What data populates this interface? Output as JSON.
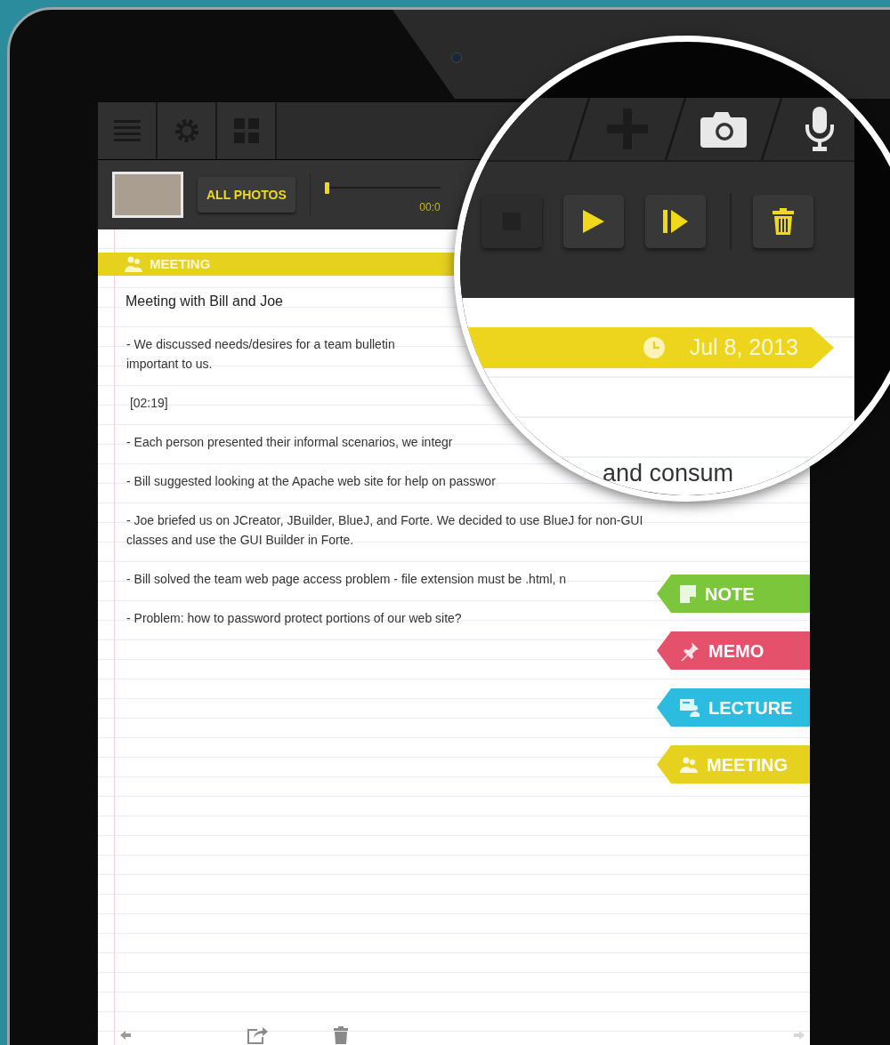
{
  "toolbar": {
    "buttons": [
      {
        "kind": "menu"
      },
      {
        "kind": "settings"
      },
      {
        "kind": "grid"
      }
    ]
  },
  "media_bar": {
    "photos_button": "ALL PHOTOS",
    "timeline": {
      "level": 0
    },
    "time": "00:0"
  },
  "category": {
    "kind": "meeting",
    "label": "MEETING"
  },
  "note": {
    "title": "Meeting with Bill and Joe",
    "paragraphs": [
      {
        "lines": [
          "- We discussed needs/desires for a team bulletin",
          "important to us."
        ]
      },
      {
        "lines": [
          " [02:19]"
        ]
      },
      {
        "lines": [
          "- Each person presented their informal scenarios, we integr"
        ]
      },
      {
        "lines": [
          "- Bill suggested looking at the Apache web site for help on passwor"
        ]
      },
      {
        "lines": [
          "- Joe briefed us on JCreator, JBuilder, BlueJ, and Forte. We decided to use BlueJ for non-GUI",
          "classes and use the GUI Builder in Forte."
        ]
      },
      {
        "lines": [
          "- Bill solved the team web page access problem - file extension must be .html, n"
        ]
      },
      {
        "lines": [
          "- Problem: how to password protect portions of our web site?"
        ]
      }
    ]
  },
  "tags": [
    {
      "kind": "note",
      "label": "NOTE",
      "color": "#7cc63c"
    },
    {
      "kind": "memo",
      "label": "MEMO",
      "color": "#e5506a"
    },
    {
      "kind": "lecture",
      "label": "LECTURE",
      "color": "#2bbcdf"
    },
    {
      "kind": "meeting",
      "label": "MEETING",
      "color": "#e6d11e"
    }
  ],
  "magnifier": {
    "tabs": [
      {
        "kind": "add"
      },
      {
        "kind": "camera"
      },
      {
        "kind": "mic"
      }
    ],
    "player": [
      {
        "kind": "stop",
        "disabled": true
      },
      {
        "kind": "play",
        "disabled": false
      },
      {
        "kind": "step",
        "disabled": false
      },
      {
        "kind": "trash",
        "disabled": false
      }
    ],
    "date": "Jul 8, 2013",
    "text": "and consum"
  }
}
